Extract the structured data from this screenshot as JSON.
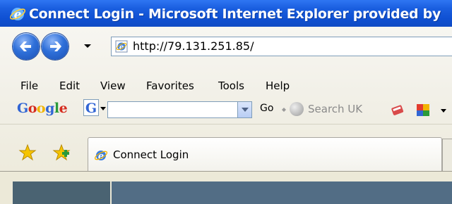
{
  "window": {
    "title": "Connect Login - Microsoft Internet Explorer provided by"
  },
  "address_bar": {
    "url": "http://79.131.251.85/"
  },
  "menu": {
    "items": [
      "File",
      "Edit",
      "View",
      "Favorites",
      "Tools",
      "Help"
    ]
  },
  "google_toolbar": {
    "logo": "Google",
    "g_button": "G",
    "go_label": "Go",
    "search_uk_label": "Search UK"
  },
  "tabs": {
    "active_label": "Connect Login"
  },
  "colors": {
    "titlebar": "#0f50d2",
    "toolbar_bg": "#ece9d8",
    "content_bg": "#526d85"
  }
}
